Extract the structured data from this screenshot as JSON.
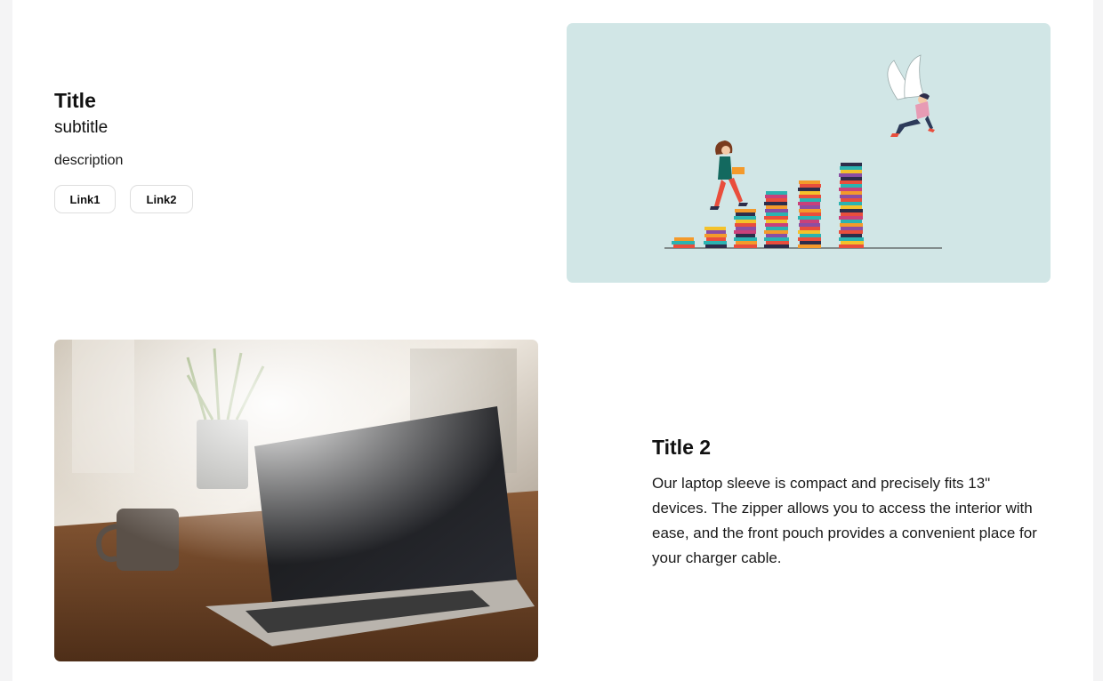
{
  "hero": {
    "title": "Title",
    "subtitle": "subtitle",
    "description": "description",
    "links": [
      {
        "label": "Link1"
      },
      {
        "label": "Link2"
      }
    ]
  },
  "feature": {
    "title": "Title 2",
    "body": "Our laptop sleeve is compact and precisely fits 13\" devices. The zipper allows you to access the interior with ease, and the front pouch provides a convenient place for your charger cable."
  },
  "colors": {
    "illustration_bg": "#d1e6e6",
    "page_bg": "#ffffff"
  }
}
